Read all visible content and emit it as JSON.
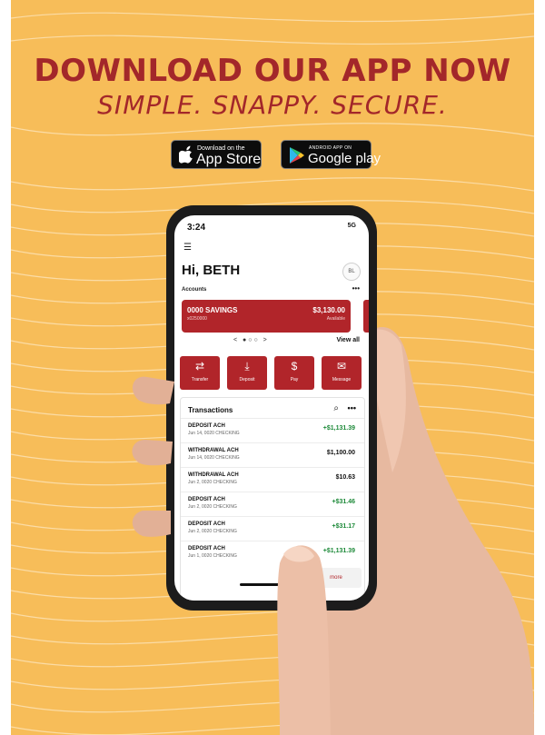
{
  "poster": {
    "headline": "DOWNLOAD OUR APP NOW",
    "tagline": "SIMPLE. SNAPPY. SECURE.",
    "app_store": {
      "small": "Download on the",
      "big": "App Store"
    },
    "google_play": {
      "small": "ANDROID APP ON",
      "big": "Google play"
    }
  },
  "status": {
    "time": "3:24",
    "signal": "5G"
  },
  "greeting": "Hi, BETH",
  "avatar": "BL",
  "accounts": {
    "label": "Accounts",
    "more": "•••",
    "card": {
      "name": "0000 SAVINGS",
      "number": "x0250000",
      "balance": "$3,130.00",
      "available": "Available"
    },
    "view_all": "View all"
  },
  "actions": [
    {
      "label": "Transfer",
      "icon": "transfer-icon"
    },
    {
      "label": "Deposit",
      "icon": "deposit-icon"
    },
    {
      "label": "Pay",
      "icon": "pay-icon"
    },
    {
      "label": "Message",
      "icon": "message-icon"
    }
  ],
  "transactions": {
    "title": "Transactions",
    "rows": [
      {
        "desc": "DEPOSIT ACH",
        "sub": "Jun 14, 0020 CHECKING",
        "amount": "+$1,131.39"
      },
      {
        "desc": "WITHDRAWAL ACH",
        "sub": "Jun 14, 0020 CHECKING",
        "amount": "$1,100.00"
      },
      {
        "desc": "WITHDRAWAL ACH",
        "sub": "Jun 2, 0020 CHECKING",
        "amount": "$10.63"
      },
      {
        "desc": "DEPOSIT ACH",
        "sub": "Jun 2, 0020 CHECKING",
        "amount": "+$31.46"
      },
      {
        "desc": "DEPOSIT ACH",
        "sub": "Jun 2, 0020 CHECKING",
        "amount": "+$31.17"
      },
      {
        "desc": "DEPOSIT ACH",
        "sub": "Jun 1, 0020 CHECKING",
        "amount": "+$1,131.39"
      }
    ],
    "more": "more"
  },
  "colors": {
    "background": "#f7bd59",
    "brand_red": "#a3272a",
    "card_red": "#b1252a",
    "positive_green": "#1e8a3a",
    "dark": "#111111"
  }
}
